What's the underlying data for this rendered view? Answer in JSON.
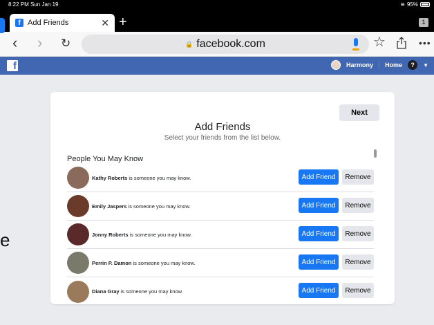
{
  "status": {
    "time": "8:22 PM  Sun Jan 19",
    "battery": "95%"
  },
  "browser": {
    "tab_title": "Add Friends",
    "tab_count": "1",
    "url": "facebook.com"
  },
  "fb": {
    "user_name": "Harmony",
    "home_label": "Home",
    "help": "?"
  },
  "page": {
    "next_label": "Next",
    "title": "Add Friends",
    "subtitle": "Select your friends from the list below.",
    "section_title": "People You May Know"
  },
  "people": [
    {
      "name": "Kathy Roberts",
      "suffix": " is someone you may know.",
      "add": "Add Friend",
      "remove": "Remove",
      "avatar_color": "#8a6a5a"
    },
    {
      "name": "Emily Jaspers",
      "suffix": " is someone you may know.",
      "add": "Add Friend",
      "remove": "Remove",
      "avatar_color": "#6a3a2a"
    },
    {
      "name": "Jonny Roberts",
      "suffix": " is someone you may know.",
      "add": "Add Friend",
      "remove": "Remove",
      "avatar_color": "#5a2a2a"
    },
    {
      "name": "Perrin P. Damon",
      "suffix": " is someone you may know.",
      "add": "Add Friend",
      "remove": "Remove",
      "avatar_color": "#7a7a6a"
    },
    {
      "name": "Diana Gray",
      "suffix": " is someone you may know.",
      "add": "Add Friend",
      "remove": "Remove",
      "avatar_color": "#9a7a5a"
    }
  ],
  "colors": {
    "fb_blue": "#4267b2",
    "button_blue": "#1877f2"
  }
}
